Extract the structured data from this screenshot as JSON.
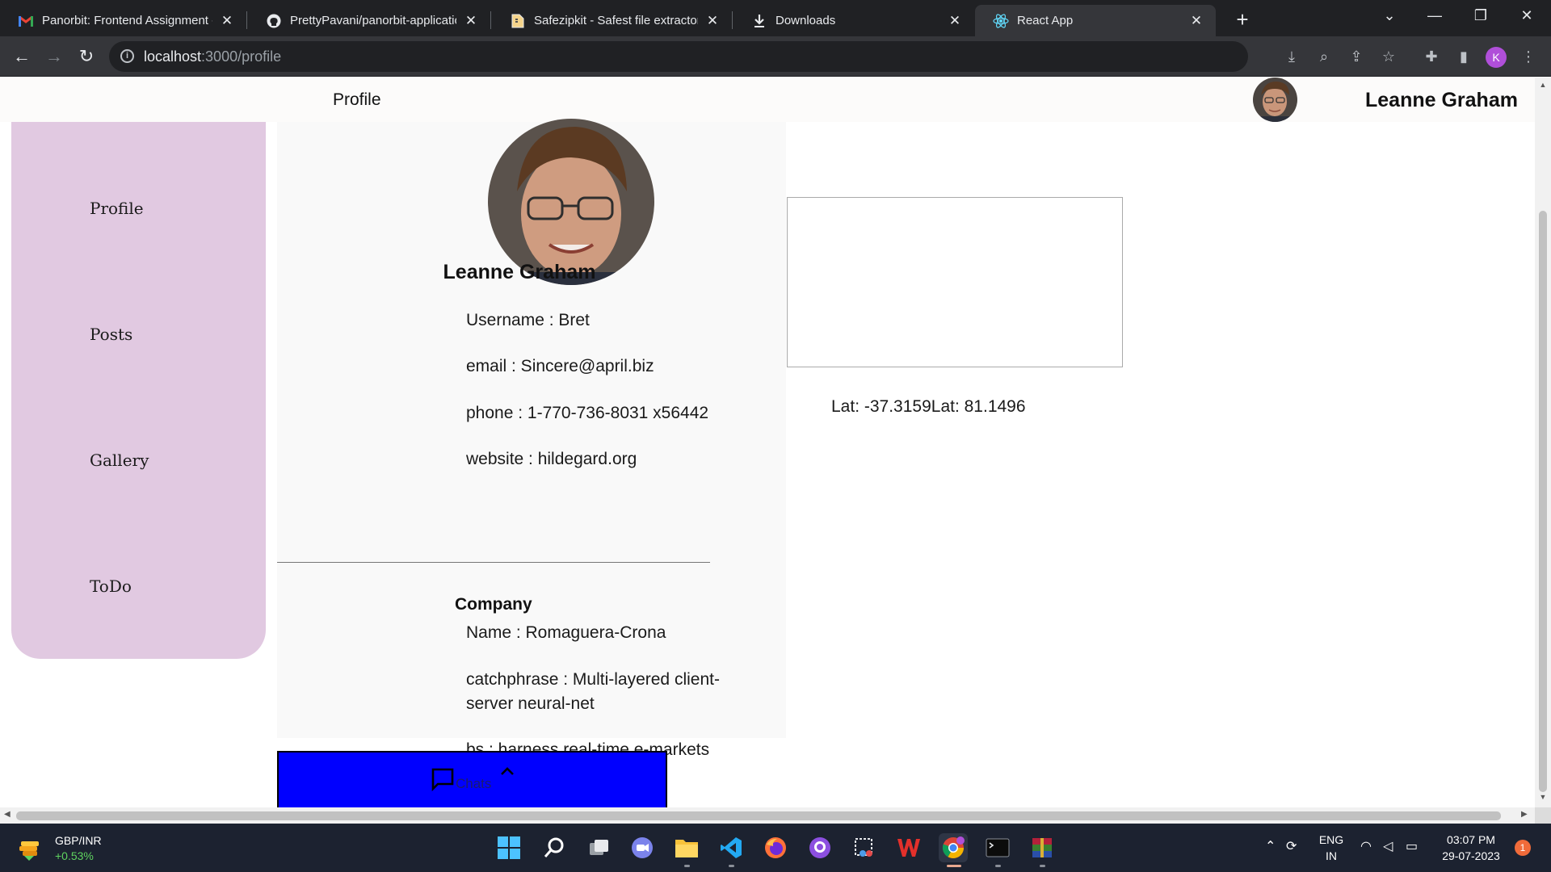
{
  "browser": {
    "tabs": [
      {
        "title": "Panorbit: Frontend Assignment -",
        "icon": "gmail-icon"
      },
      {
        "title": "PrettyPavani/panorbit-application",
        "icon": "github-icon"
      },
      {
        "title": "Safezipkit - Safest file extractor an",
        "icon": "file-icon"
      },
      {
        "title": "Downloads",
        "icon": "download-icon"
      },
      {
        "title": "React App",
        "icon": "react-icon"
      }
    ],
    "url_host": "localhost",
    "url_path": ":3000/profile",
    "profile_initial": "K"
  },
  "header": {
    "title": "Profile",
    "user_name": "Leanne Graham"
  },
  "sidebar": {
    "items": [
      {
        "label": "Profile"
      },
      {
        "label": "Posts"
      },
      {
        "label": "Gallery"
      },
      {
        "label": "ToDo"
      }
    ]
  },
  "profile": {
    "name": "Leanne Graham",
    "username": "Username : Bret",
    "email": "email : Sincere@april.biz",
    "phone": "phone : 1-770-736-8031 x56442",
    "website": "website : hildegard.org"
  },
  "company": {
    "heading": "Company",
    "name": "Name : Romaguera-Crona",
    "catchphrase_line1": "catchphrase : Multi-layered client-",
    "catchphrase_line2": "server neural-net",
    "bs": "bs : harness real-time e-markets"
  },
  "location": {
    "latlng": "Lat: -37.3159Lat: 81.1496"
  },
  "chats": {
    "label": "Chats"
  },
  "taskbar": {
    "widget_pair": "GBP/INR",
    "widget_change": "+0.53%",
    "lang": "ENG",
    "region": "IN",
    "time": "03:07 PM",
    "date": "29-07-2023",
    "notifications": "1"
  },
  "colors": {
    "sidebar_bg": "#e1c9e1",
    "chats_bar": "#0000ff",
    "header_bg": "#fcfbfa"
  }
}
